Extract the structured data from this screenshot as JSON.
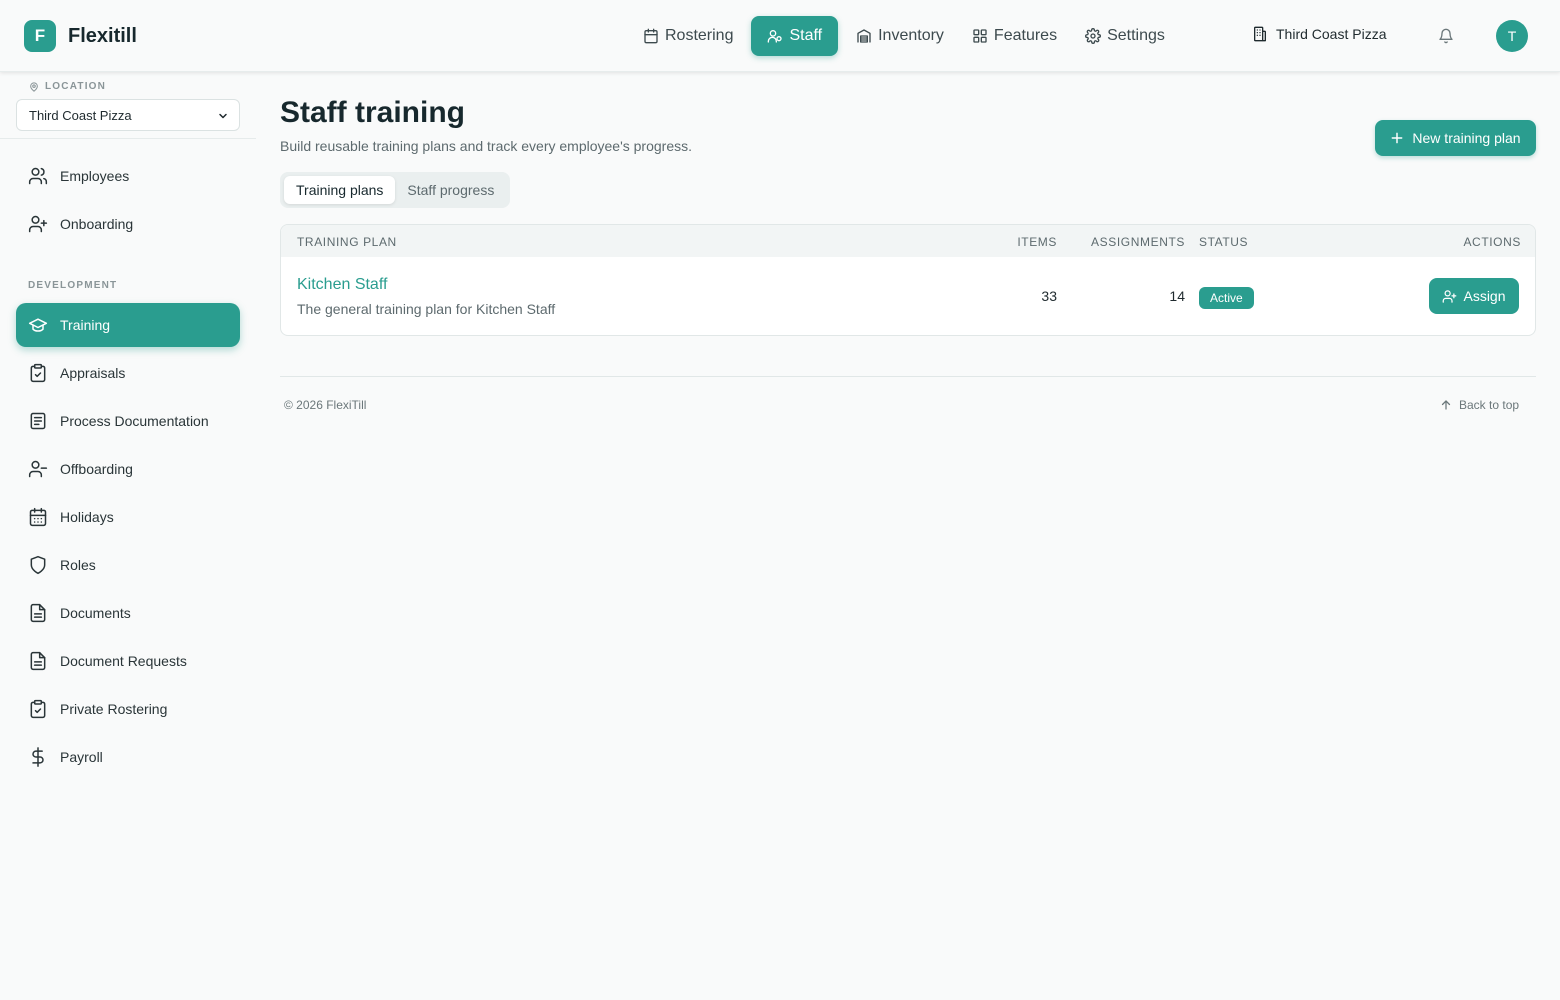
{
  "app": {
    "logo_letter": "F",
    "name": "Flexitill"
  },
  "nav": {
    "items": [
      {
        "label": "Rostering",
        "icon": "calendar-icon"
      },
      {
        "label": "Staff",
        "icon": "users-icon",
        "active": true
      },
      {
        "label": "Inventory",
        "icon": "warehouse-icon"
      },
      {
        "label": "Features",
        "icon": "grid-icon"
      },
      {
        "label": "Settings",
        "icon": "gear-icon"
      }
    ],
    "store_name": "Third Coast Pizza",
    "avatar_letter": "T"
  },
  "sidebar": {
    "location_label": "LOCATION",
    "location_value": "Third Coast Pizza",
    "top_items": [
      {
        "label": "Employees",
        "icon": "users-icon"
      },
      {
        "label": "Onboarding",
        "icon": "user-plus-icon"
      }
    ],
    "section_label": "DEVELOPMENT",
    "dev_items": [
      {
        "label": "Training",
        "icon": "graduation-cap-icon",
        "active": true
      },
      {
        "label": "Appraisals",
        "icon": "clipboard-check-icon"
      },
      {
        "label": "Process Documentation",
        "icon": "document-lines-icon"
      },
      {
        "label": "Offboarding",
        "icon": "user-minus-icon"
      },
      {
        "label": "Holidays",
        "icon": "calendar-days-icon"
      },
      {
        "label": "Roles",
        "icon": "shield-icon"
      },
      {
        "label": "Documents",
        "icon": "file-text-icon"
      },
      {
        "label": "Document Requests",
        "icon": "file-text-icon"
      },
      {
        "label": "Private Rostering",
        "icon": "clipboard-check-icon"
      },
      {
        "label": "Payroll",
        "icon": "dollar-icon"
      }
    ]
  },
  "main": {
    "title": "Staff training",
    "subtitle": "Build reusable training plans and track every employee's progress.",
    "new_button": "New training plan",
    "tabs": [
      {
        "label": "Training plans",
        "active": true
      },
      {
        "label": "Staff progress",
        "active": false
      }
    ],
    "table": {
      "headers": {
        "plan": "TRAINING PLAN",
        "items": "ITEMS",
        "assignments": "ASSIGNMENTS",
        "status": "STATUS",
        "actions": "ACTIONS"
      },
      "rows": [
        {
          "name": "Kitchen Staff",
          "description": "The general training plan for Kitchen Staff",
          "items": "33",
          "assignments": "14",
          "status": "Active",
          "action": "Assign"
        }
      ]
    }
  },
  "footer": {
    "copyright": "© 2026 FlexiTill",
    "back_to_top": "Back to top"
  },
  "colors": {
    "accent": "#2a9d8f",
    "background": "#f9fafa",
    "text": "#17282d"
  }
}
